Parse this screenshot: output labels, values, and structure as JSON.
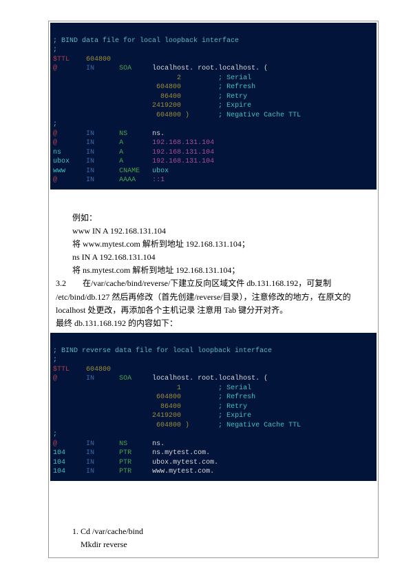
{
  "term1": {
    "comment": "; BIND data file for local loopback interface",
    "blank1": ";",
    "ttl_lbl": "$TTL",
    "ttl_val": "604800",
    "soa_at": "@",
    "soa_in": "IN",
    "soa_type": "SOA",
    "soa_mname": "localhost.",
    "soa_rname": "root.localhost. (",
    "serial_v": "2",
    "serial_c": "; Serial",
    "refresh_v": "604800",
    "refresh_c": "; Refresh",
    "retry_v": "86400",
    "retry_c": "; Retry",
    "expire_v": "2419200",
    "expire_c": "; Expire",
    "nctl_v": "604800 )",
    "nctl_c": "; Negative Cache TTL",
    "blank2": ";",
    "r1_n": "@",
    "r1_in": "IN",
    "r1_t": "NS",
    "r1_v": "ns.",
    "r2_n": "@",
    "r2_in": "IN",
    "r2_t": "A",
    "r2_v": "192.168.131.104",
    "r3_n": "ns",
    "r3_in": "IN",
    "r3_t": "A",
    "r3_v": "192.168.131.104",
    "r4_n": "ubox",
    "r4_in": "IN",
    "r4_t": "A",
    "r4_v": "192.168.131.104",
    "r5_n": "www",
    "r5_in": "IN",
    "r5_t": "CNAME",
    "r5_v": "ubox",
    "r6_n": "@",
    "r6_in": "IN",
    "r6_t": "AAAA",
    "r6_v": "::1"
  },
  "body1": {
    "l1": "例如：",
    "l2": "www IN A 192.168.131.104",
    "l3": "将 www.mytest.com  解析到地址 192.168.131.104；",
    "l4": "ns IN A 192.168.131.104",
    "l5": "将 ns.mytest.com  解析到地址 192.168.131.104；",
    "l6a": "3.2",
    "l6b": "在/var/cache/bind/reverse/下建立反向区域文件 db.131.168.192，可复制",
    "l7": "/etc/bind/db.127 然后再修改（首先创建/reverse/目录），注意修改的地方，在原文的localhost 处更改，再添加各个主机记录 注意用 Tab 键分开对齐。",
    "l8": "最终 db.131.168.192 的内容如下："
  },
  "term2": {
    "comment": "; BIND reverse data file for local loopback interface",
    "blank1": ";",
    "ttl_lbl": "$TTL",
    "ttl_val": "604800",
    "soa_at": "@",
    "soa_in": "IN",
    "soa_type": "SOA",
    "soa_mname": "localhost.",
    "soa_rname": "root.localhost. (",
    "serial_v": "1",
    "serial_c": "; Serial",
    "refresh_v": "604800",
    "refresh_c": "; Refresh",
    "retry_v": "86400",
    "retry_c": "; Retry",
    "expire_v": "2419200",
    "expire_c": "; Expire",
    "nctl_v": "604800 )",
    "nctl_c": "; Negative Cache TTL",
    "blank2": ";",
    "r1_n": "@",
    "r1_in": "IN",
    "r1_t": "NS",
    "r1_v": "ns.",
    "r2_n": "104",
    "r2_in": "IN",
    "r2_t": "PTR",
    "r2_v": "ns.mytest.com.",
    "r3_n": "104",
    "r3_in": "IN",
    "r3_t": "PTR",
    "r3_v": "ubox.mytest.com.",
    "r4_n": "104",
    "r4_in": "IN",
    "r4_t": "PTR",
    "r4_v": "www.mytest.com."
  },
  "body2": {
    "l1": "1. Cd   /var/cache/bind",
    "l2": "Mkdir reverse"
  }
}
